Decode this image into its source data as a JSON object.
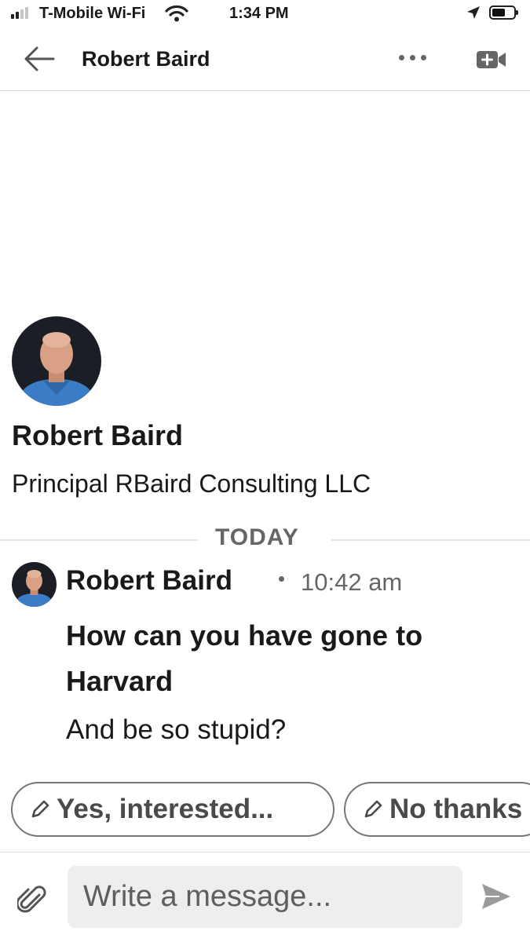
{
  "status_bar": {
    "carrier": "T-Mobile Wi-Fi",
    "time": "1:34 PM",
    "signal_icon": "signal-bars-icon",
    "wifi_icon": "wifi-icon",
    "location_icon": "location-arrow-icon",
    "battery_icon": "battery-icon"
  },
  "nav": {
    "back_icon": "back-arrow-icon",
    "title": "Robert Baird",
    "more_icon": "more-dots-icon",
    "video_icon": "video-call-icon"
  },
  "profile": {
    "name": "Robert Baird",
    "headline": "Principal RBaird Consulting LLC",
    "avatar_icon": "avatar"
  },
  "conversation": {
    "date_divider": "TODAY",
    "messages": [
      {
        "sender": "Robert Baird",
        "time": "10:42 am",
        "lines": [
          "How can you have gone to Harvard",
          "And be so stupid?"
        ]
      }
    ]
  },
  "quick_replies": [
    {
      "label": "Yes, interested...",
      "icon": "pencil-icon"
    },
    {
      "label": "No thanks",
      "icon": "pencil-icon"
    }
  ],
  "composer": {
    "placeholder": "Write a message...",
    "value": "",
    "attach_icon": "paperclip-icon",
    "send_icon": "send-icon"
  },
  "colors": {
    "text": "#191919",
    "muted": "#666666",
    "chip_border": "#777777",
    "input_bg": "#eeeeee",
    "divider": "#d9d9d9"
  }
}
